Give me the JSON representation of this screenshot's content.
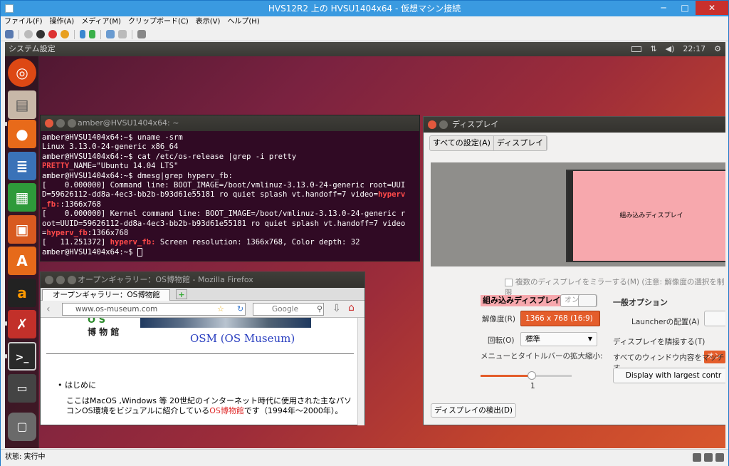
{
  "window": {
    "title": "HVS12R2 上の HVSU1404x64 - 仮想マシン接続",
    "min": "─",
    "max": "□",
    "close": "✕"
  },
  "menu": [
    "ファイル(F)",
    "操作(A)",
    "メディア(M)",
    "クリップボード(C)",
    "表示(V)",
    "ヘルプ(H)"
  ],
  "panel": {
    "title": "システム設定",
    "time": "22:17"
  },
  "terminal": {
    "title": "amber@HVSU1404x64: ~",
    "lines": [
      "amber@HVSU1404x64:~$ uname -srm",
      "Linux 3.13.0-24-generic x86_64",
      "amber@HVSU1404x64:~$ cat /etc/os-release |grep -i pretty"
    ],
    "pretty_key": "PRETTY",
    "pretty_rest": "_NAME=\"Ubuntu 14.04 LTS\"",
    "dmesg_cmd": "amber@HVSU1404x64:~$ dmesg|grep hyperv_fb:",
    "d1a": "[    0.000000] Command line: BOOT_IMAGE=/boot/vmlinuz-3.13.0-24-generic root=UUI",
    "d1b": "D=59626112-dd8a-4ec3-bb2b-b93d61e55181 ro quiet splash vt.handoff=7 video=",
    "hyperv": "hyperv",
    "fb_tail": "_fb:",
    "d1c": ":1366x768",
    "d2a": "[    0.000000] Kernel command line: BOOT_IMAGE=/boot/vmlinuz-3.13.0-24-generic r",
    "d2b": "oot=UUID=59626112-dd8a-4ec3-bb2b-b93d61e55181 ro quiet splash vt.handoff=7 video",
    "d2c_pre": "=",
    "hyperv_fb": "hyperv_fb",
    "d2c_post": ":1366x768",
    "d3_pre": "[   11.251372] ",
    "hyperv_fb2": "hyperv_fb:",
    "d3_post": " Screen resolution: 1366x768, Color depth: 32",
    "prompt": "amber@HVSU1404x64:~$ "
  },
  "firefox": {
    "title": "オープンギャラリー：OS博物館 - Mozilla Firefox",
    "tab": "オープンギャラリー：OS博物館",
    "url": "www.os-museum.com",
    "search": "Google",
    "logo_os": "O S",
    "logo_kanji": "博 物 館",
    "banner": "OSM (OS Museum)",
    "bullet": "はじめに",
    "body_pre": "ここはMacOS ,Windows 等 20世紀のインターネット時代に使用された主なパソコンOS環境をビジュアルに紹介している",
    "body_link": "OS博物館",
    "body_post": "です（1994年～2000年）。"
  },
  "display": {
    "title": "ディスプレイ",
    "crumb_all": "すべての設定(A)",
    "crumb_disp": "ディスプレイ",
    "monitor_label": "組み込みディスプレイ",
    "mirror": "複数のディスプレイをミラーする(M) (注意: 解像度の選択を制限",
    "selected_display": "組み込みディスプレイ",
    "on_label": "オン",
    "resolution_label": "解像度(R)",
    "resolution_value": "1366 x 768 (16:9)",
    "rotation_label": "回転(O)",
    "rotation_value": "標準",
    "scale_label": "メニューとタイトルバーの拡大縮小:",
    "scale_value": "1",
    "detect_button": "ディスプレイの検出(D)",
    "general_title": "一般オプション",
    "launcher_label": "Launcherの配置(A)",
    "sticky_label": "ディスプレイを隣接する(T)",
    "sticky_value": "オン",
    "scale_all_label": "すべてのウィンドウ内容をマッチす",
    "largest_button": "Display with largest contr"
  },
  "status": {
    "text": "状態: 実行中"
  },
  "colors": {
    "accent": "#e45d2b",
    "terminal_bg": "#300a24",
    "title_blue": "#3a9ae0"
  }
}
